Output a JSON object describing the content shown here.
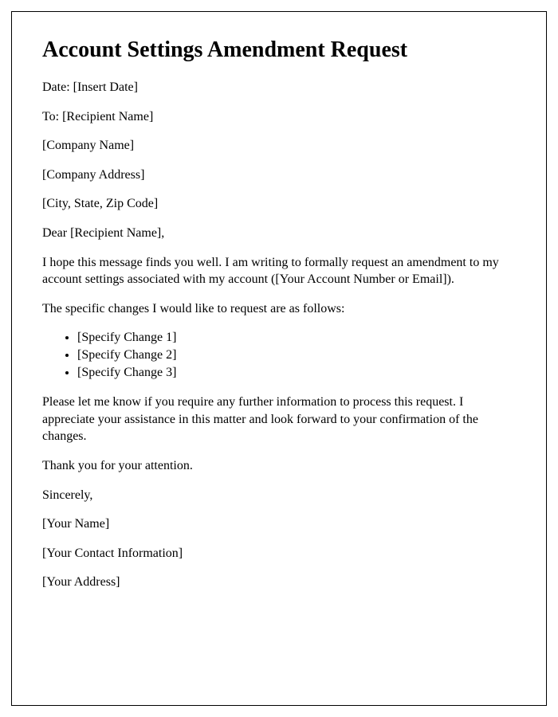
{
  "title": "Account Settings Amendment Request",
  "date_line": "Date: [Insert Date]",
  "to_line": "To: [Recipient Name]",
  "company_name": "[Company Name]",
  "company_address": "[Company Address]",
  "city_state_zip": "[City, State, Zip Code]",
  "salutation": "Dear [Recipient Name],",
  "intro": "I hope this message finds you well. I am writing to formally request an amendment to my account settings associated with my account ([Your Account Number or Email]).",
  "changes_intro": "The specific changes I would like to request are as follows:",
  "changes": [
    "[Specify Change 1]",
    "[Specify Change 2]",
    "[Specify Change 3]"
  ],
  "closing_para": "Please let me know if you require any further information to process this request. I appreciate your assistance in this matter and look forward to your confirmation of the changes.",
  "thank_you": "Thank you for your attention.",
  "signoff": "Sincerely,",
  "your_name": "[Your Name]",
  "your_contact": "[Your Contact Information]",
  "your_address": "[Your Address]"
}
